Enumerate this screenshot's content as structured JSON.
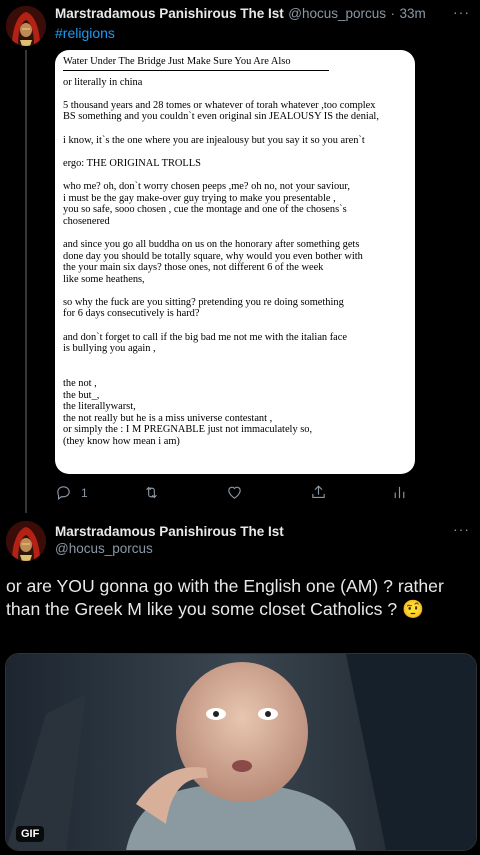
{
  "tweet1": {
    "author_name": "Marstradamous Panishirous The Ist",
    "author_handle": "@hocus_porcus",
    "separator": "·",
    "time": "33m",
    "hashtag": "#religions",
    "more_label": "···",
    "document_lines": [
      "Water Under The Bridge Just Make Sure You Are Also",
      "",
      "or literally in china",
      "",
      "5 thousand years and 28 tomes or whatever of torah whatever ,too complex",
      "BS something and you couldn`t even original sin JEALOUSY IS the denial,",
      "",
      "i know, it`s the one where you are injealousy but you say it so you aren`t",
      "",
      "ergo: THE ORIGINAL TROLLS",
      "",
      "who me? oh, don`t worry chosen peeps ,me? oh no, not your saviour,",
      "i must be the gay make-over guy trying to make you presentable ,",
      "you so safe, sooo chosen , cue the montage and one of the chosens`s",
      "chosenered",
      "",
      "and since you go all buddha on us on the honorary after something gets",
      "done day you should be totally square, why would you even bother with",
      "the your main six days? those ones, not different 6 of the week",
      "like some heathens,",
      "",
      "so why the fuck are you sitting? pretending you re doing something",
      "for 6 days consecutively is hard?",
      "",
      "and don`t forget to call if the big bad me not me with the italian face",
      "is bullying you again ,",
      "",
      "",
      "the not ,",
      "the but_,",
      "the literallywarst,",
      "the not really but he is a miss universe contestant ,",
      "or simply the : I M PREGNABLE just not immaculately so,",
      "(they know how mean i am)"
    ],
    "reply_count": "1",
    "retweet_count": "",
    "like_count": "",
    "icons": [
      "reply-icon",
      "retweet-icon",
      "like-icon",
      "share-icon",
      "analytics-icon"
    ]
  },
  "tweet2": {
    "author_name": "Marstradamous Panishirous The Ist",
    "author_handle": "@hocus_porcus",
    "more_label": "···",
    "text": "or are YOU gonna go with the English one (AM) ? rather than the Greek M like you some closet Catholics ? 🤨",
    "gif_badge": "GIF"
  },
  "colors": {
    "background": "#000000",
    "text": "#e7e9ea",
    "secondary": "#8b98a5",
    "link": "#1d9bf0",
    "divider": "#333639"
  }
}
